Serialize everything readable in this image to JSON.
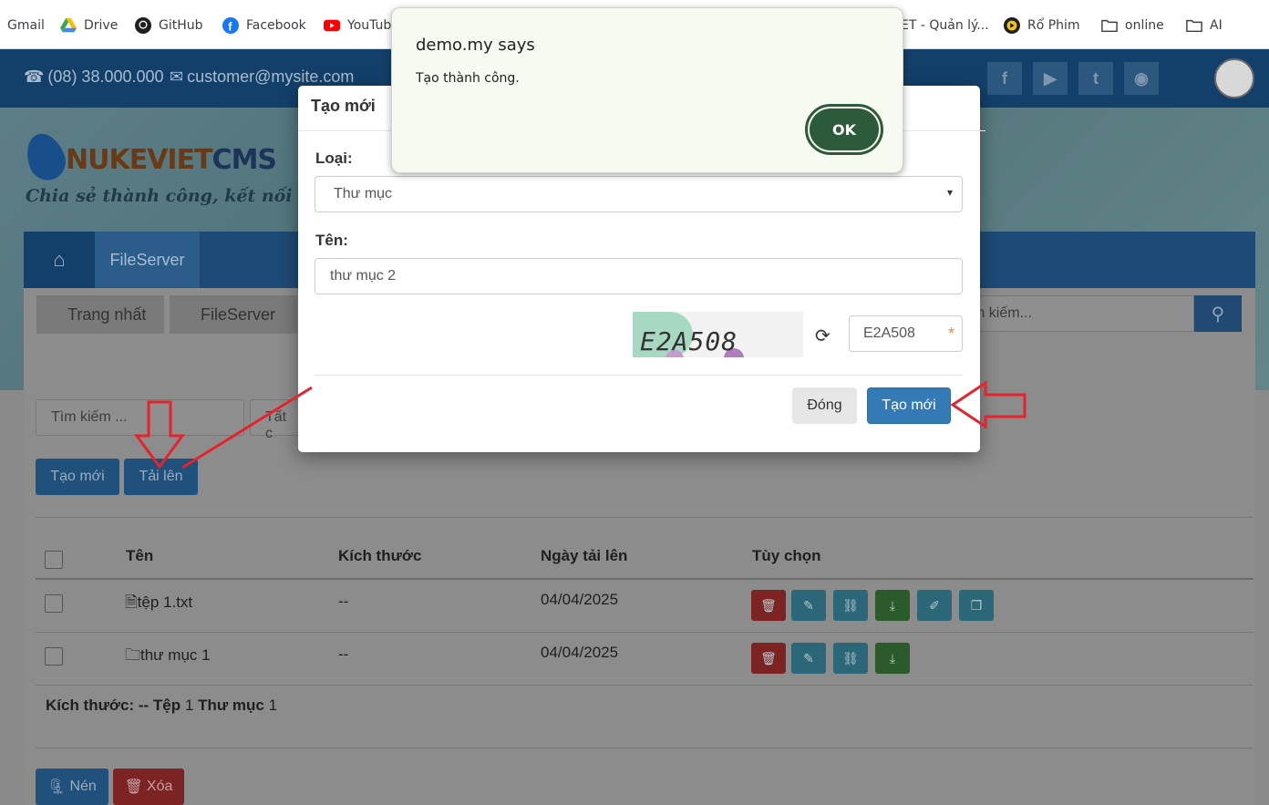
{
  "bookmarks": [
    {
      "label": "Gmail",
      "icon": "gmail-icon"
    },
    {
      "label": "Drive",
      "icon": "drive-icon"
    },
    {
      "label": "GitHub",
      "icon": "github-icon"
    },
    {
      "label": "Facebook",
      "icon": "facebook-icon"
    },
    {
      "label": "YouTub",
      "icon": "youtube-icon"
    },
    {
      "label": "ET - Quản lý...",
      "icon": ""
    },
    {
      "label": "Rổ Phim",
      "icon": "film-icon"
    },
    {
      "label": "online",
      "icon": "folder-icon"
    },
    {
      "label": "AI",
      "icon": "folder-icon"
    }
  ],
  "topbar": {
    "phone": "(08) 38.000.000",
    "email": "customer@mysite.com"
  },
  "site": {
    "logo_part1": "NUKEVIET",
    "logo_part2": "CMS",
    "slogan": "Chia sẻ thành công, kết nối đam"
  },
  "nav": {
    "fileserver": "FileServer"
  },
  "breadcrumb": [
    "Trang nhất",
    "FileServer"
  ],
  "search": {
    "right_placeholder": "m kiếm...",
    "left_placeholder": "Tìm kiếm ...",
    "filter_text": "Tất c"
  },
  "actions": {
    "create": "Tạo mới",
    "upload": "Tải lên",
    "compress": "Nén",
    "delete": "Xóa"
  },
  "table": {
    "headers": [
      "Tên",
      "Kích thước",
      "Ngày tải lên",
      "Tùy chọn"
    ],
    "rows": [
      {
        "name": "tệp 1.txt",
        "size": "--",
        "date": "04/04/2025",
        "type": "file"
      },
      {
        "name": "thư mục 1",
        "size": "--",
        "date": "04/04/2025",
        "type": "folder"
      }
    ],
    "summary_label": "Kích thước:",
    "summary_size": "--",
    "summary_file_label": "Tệp",
    "summary_file_count": "1",
    "summary_folder_label": "Thư mục",
    "summary_folder_count": "1"
  },
  "modal": {
    "title": "Tạo mới",
    "type_label": "Loại:",
    "type_value": "Thư mục",
    "name_label": "Tên:",
    "name_value": "thư mục 2",
    "captcha_text": "E2A508",
    "captcha_input": "E2A508",
    "close_button": "Đóng",
    "create_button": "Tạo mới"
  },
  "alert": {
    "title": "demo.my says",
    "message": "Tạo thành công.",
    "ok": "OK"
  },
  "colors": {
    "accent_arrow": "#e8222a",
    "primary": "#337ab7",
    "alert_ok": "#2d5a3a"
  }
}
